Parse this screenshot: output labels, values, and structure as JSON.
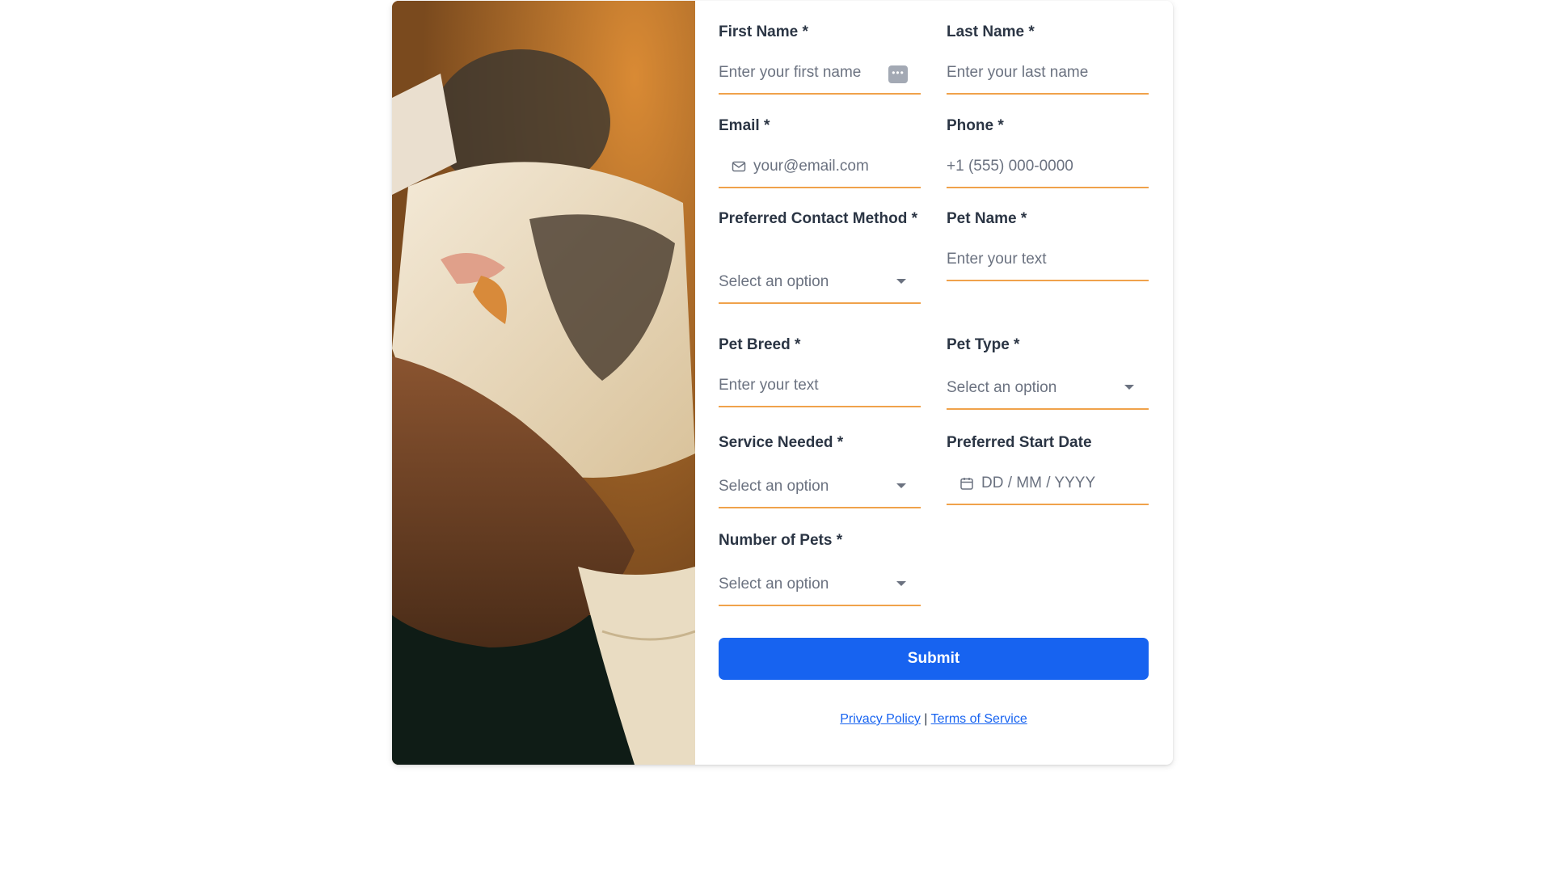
{
  "form": {
    "first_name": {
      "label": "First Name *",
      "placeholder": "Enter your first name"
    },
    "last_name": {
      "label": "Last Name *",
      "placeholder": "Enter your last name"
    },
    "email": {
      "label": "Email *",
      "placeholder": "your@email.com",
      "icon": "mail-icon"
    },
    "phone": {
      "label": "Phone *",
      "placeholder": "+1 (555) 000-0000"
    },
    "contact_method": {
      "label": "Preferred Contact Method *",
      "placeholder": "Select an option"
    },
    "pet_name": {
      "label": "Pet Name *",
      "placeholder": "Enter your text"
    },
    "pet_breed": {
      "label": "Pet Breed *",
      "placeholder": "Enter your text"
    },
    "pet_type": {
      "label": "Pet Type *",
      "placeholder": "Select an option"
    },
    "service_needed": {
      "label": "Service Needed *",
      "placeholder": "Select an option"
    },
    "start_date": {
      "label": "Preferred Start Date",
      "placeholder": "DD / MM / YYYY",
      "icon": "calendar-icon"
    },
    "num_pets": {
      "label": "Number of Pets *",
      "placeholder": "Select an option"
    },
    "submit_label": "Submit"
  },
  "footer": {
    "privacy": "Privacy Policy",
    "separator": " | ",
    "terms": "Terms of Service"
  },
  "colors": {
    "accent_underline": "#f0a24b",
    "button": "#1763f0"
  },
  "image": {
    "subject": "cat-photo"
  }
}
